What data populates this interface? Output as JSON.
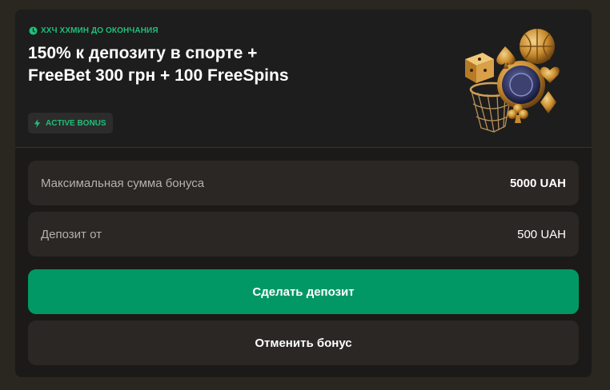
{
  "bonus": {
    "timer_text": "ХХЧ ХХМИН ДО ОКОНЧАНИЯ",
    "title_line1": "150% к депозиту в спорте +",
    "title_line2": "FreeBet 300 грн + 100 FreeSpins",
    "status_badge": "ACTIVE BONUS",
    "icons": {
      "timer": "clock-icon",
      "badge": "lightning-icon",
      "art": "casino-chip-basketball-icon"
    }
  },
  "details": [
    {
      "label": "Максимальная сумма бонуса",
      "value": "5000 UAH"
    },
    {
      "label": "Депозит от",
      "value": "500 UAH"
    }
  ],
  "actions": {
    "deposit_label": "Сделать депозит",
    "cancel_label": "Отменить бонус"
  },
  "colors": {
    "accent": "#1fbf7a",
    "primary_button": "#029866",
    "card_bg": "#1b1a19",
    "row_bg": "#2a2724",
    "page_bg": "#2a2620"
  }
}
